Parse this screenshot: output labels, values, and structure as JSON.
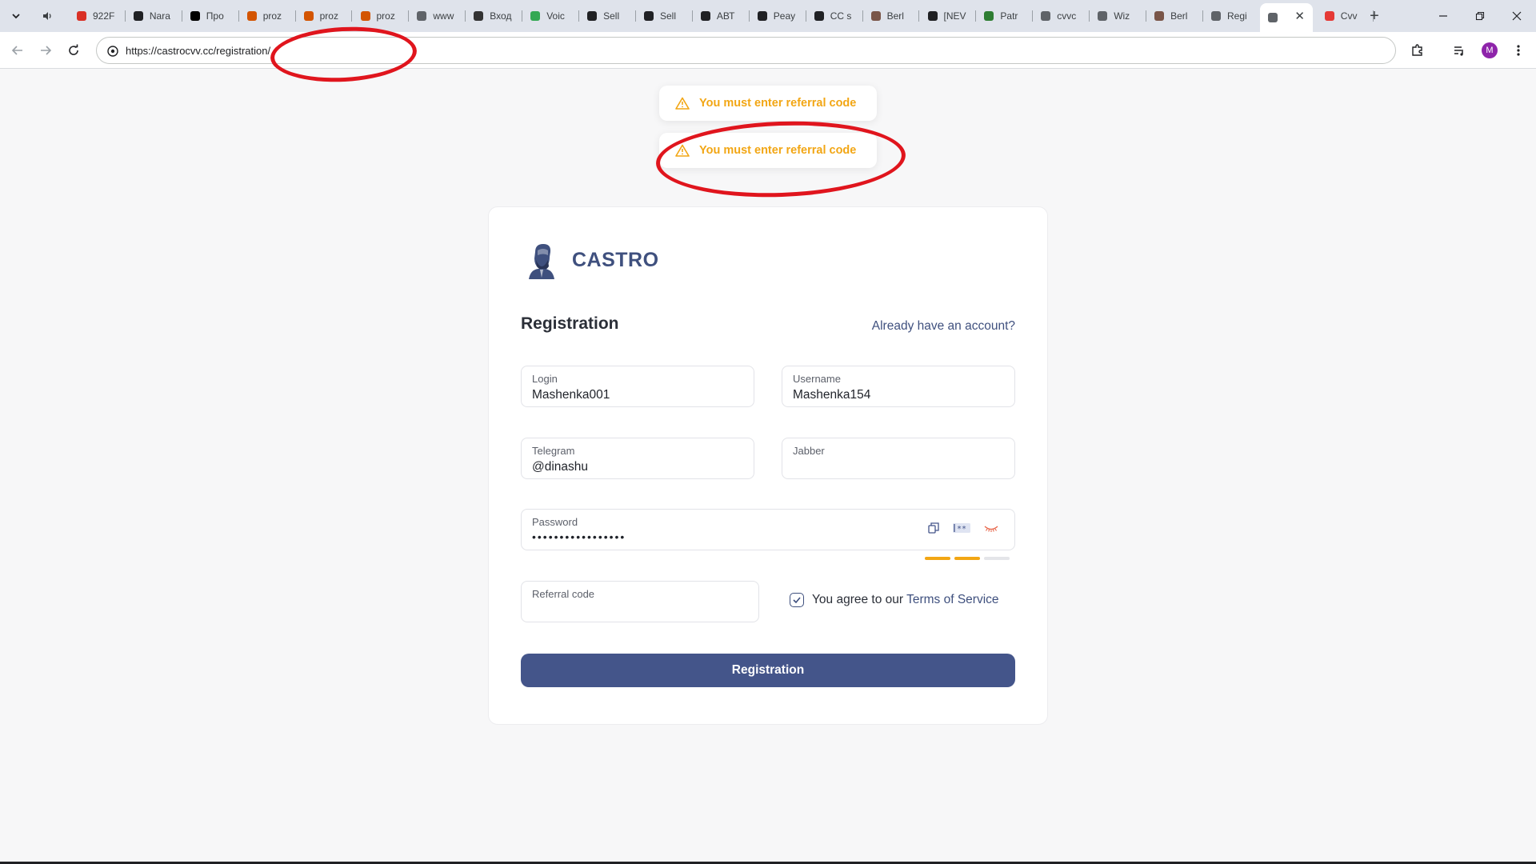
{
  "browser": {
    "tabs": [
      {
        "label": "922F"
      },
      {
        "label": "Nara"
      },
      {
        "label": "Про"
      },
      {
        "label": "proz"
      },
      {
        "label": "proz"
      },
      {
        "label": "proz"
      },
      {
        "label": "www"
      },
      {
        "label": "Вход"
      },
      {
        "label": "Voic"
      },
      {
        "label": "Sell"
      },
      {
        "label": "Sell"
      },
      {
        "label": "АВТ"
      },
      {
        "label": "Peay"
      },
      {
        "label": "CC s"
      },
      {
        "label": "Berl"
      },
      {
        "label": "[NEV"
      },
      {
        "label": "Patr"
      },
      {
        "label": "cvvc"
      },
      {
        "label": "Wiz"
      },
      {
        "label": "Berl"
      },
      {
        "label": "Regi"
      },
      {
        "label": ""
      },
      {
        "label": "Cvv"
      }
    ],
    "url": "https://castrocvv.cc/registration/",
    "profile_initial": "M"
  },
  "toasts": [
    {
      "message": "You must enter referral code"
    },
    {
      "message": "You must enter referral code"
    }
  ],
  "brand": {
    "name": "CASTRO"
  },
  "form": {
    "title": "Registration",
    "signin_link": "Already have an account?",
    "login": {
      "label": "Login",
      "value": "Mashenka001"
    },
    "username": {
      "label": "Username",
      "value": "Mashenka154"
    },
    "telegram": {
      "label": "Telegram",
      "value": "@dinashu"
    },
    "jabber": {
      "label": "Jabber",
      "value": ""
    },
    "password": {
      "label": "Password",
      "masked_value": "•••••••••••••••••"
    },
    "password_strength": {
      "filled_segments": 2,
      "total_segments": 3
    },
    "referral": {
      "label": "Referral code",
      "value": ""
    },
    "terms_text": "You agree to our",
    "terms_link": "Terms of Service",
    "terms_checked": true,
    "submit_label": "Registration"
  },
  "colors": {
    "accent": "#3f507e",
    "button": "#44558a",
    "warning": "#f2a614",
    "annotation": "#e0151d"
  }
}
